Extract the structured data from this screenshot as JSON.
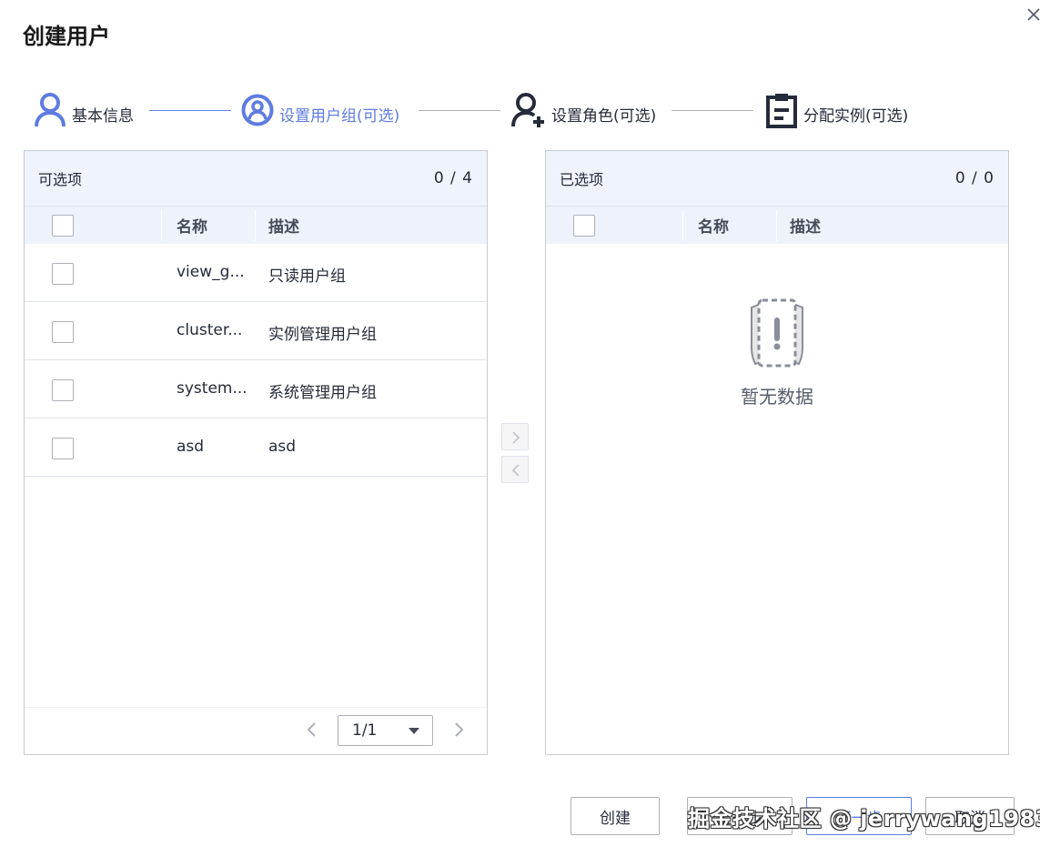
{
  "dialog": {
    "title": "创建用户"
  },
  "colors": {
    "accent": "#5e7ce0",
    "text": "#252b3a",
    "border": "#c7cbd3",
    "header_bg": "#eef3fc"
  },
  "steps": [
    {
      "label": "基本信息",
      "icon": "user-icon",
      "state": "done"
    },
    {
      "label": "设置用户组(可选)",
      "icon": "user-group-icon",
      "state": "active"
    },
    {
      "label": "设置角色(可选)",
      "icon": "user-add-icon",
      "state": "pending"
    },
    {
      "label": "分配实例(可选)",
      "icon": "clipboard-icon",
      "state": "pending"
    }
  ],
  "left_panel": {
    "title": "可选项",
    "count": "0 / 4",
    "columns": {
      "name": "名称",
      "description": "描述"
    },
    "rows": [
      {
        "name": "view_g...",
        "description": "只读用户组"
      },
      {
        "name": "cluster...",
        "description": "实例管理用户组"
      },
      {
        "name": "system...",
        "description": "系统管理用户组"
      },
      {
        "name": "asd",
        "description": "asd"
      }
    ],
    "pagination": {
      "current": "1/1"
    }
  },
  "right_panel": {
    "title": "已选项",
    "count": "0 / 0",
    "columns": {
      "name": "名称",
      "description": "描述"
    },
    "empty_text": "暂无数据"
  },
  "footer": {
    "create_label": "创建",
    "prev_label": "上一步",
    "next_label": "下一步",
    "cancel_label": "取消"
  },
  "watermark": "掘金技术社区 @ jerrywang1983"
}
